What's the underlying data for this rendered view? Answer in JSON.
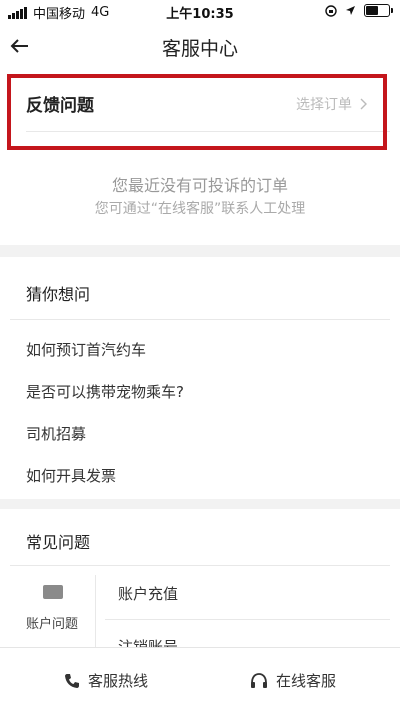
{
  "status_bar": {
    "carrier": "中国移动",
    "network": "4G",
    "time": "上午10:35"
  },
  "nav": {
    "title": "客服中心",
    "back_icon": "arrow-left-icon"
  },
  "feedback": {
    "title": "反馈问题",
    "select_label": "选择订单",
    "empty_title": "您最近没有可投诉的订单",
    "empty_subtitle": "您可通过“在线客服”联系人工处理"
  },
  "guess": {
    "title": "猜你想问",
    "items": [
      "如何预订首汽约车",
      "是否可以携带宠物乘车?",
      "司机招募",
      "如何开具发票"
    ]
  },
  "faq": {
    "title": "常见问题",
    "category": {
      "label": "账户问题",
      "icon": "id-card-icon"
    },
    "items": [
      "账户充值",
      "注销账号"
    ]
  },
  "bottom": {
    "hotline_label": "客服热线",
    "hotline_icon": "phone-icon",
    "online_label": "在线客服",
    "online_icon": "headset-icon"
  },
  "colors": {
    "highlight": "#c4161c",
    "muted_text": "#999999"
  }
}
